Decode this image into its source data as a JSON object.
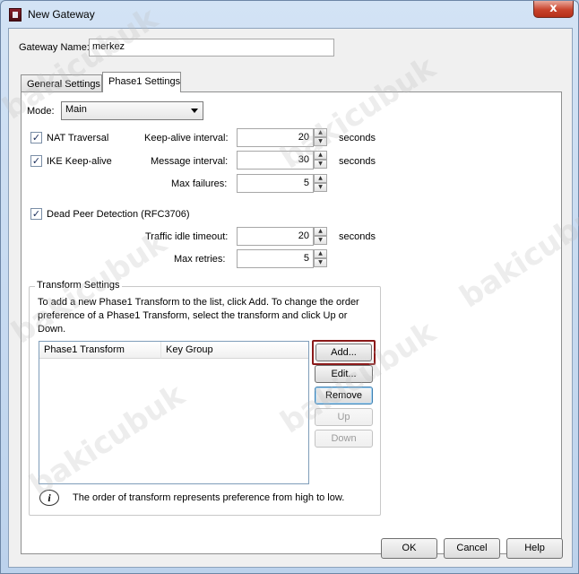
{
  "window": {
    "title": "New Gateway",
    "close_glyph": "x"
  },
  "gateway_name": {
    "label": "Gateway Name:",
    "value": "merkez"
  },
  "tabs": [
    {
      "label": "General Settings",
      "active": false
    },
    {
      "label": "Phase1 Settings",
      "active": true
    }
  ],
  "mode": {
    "label": "Mode:",
    "selected": "Main"
  },
  "nat_traversal": {
    "label": "NAT Traversal",
    "checked": true
  },
  "ike_keepalive": {
    "label": "IKE Keep-alive",
    "checked": true
  },
  "dpd": {
    "label": "Dead Peer Detection (RFC3706)",
    "checked": true
  },
  "check_glyph": "✓",
  "spinner_up": "▲",
  "spinner_down": "▼",
  "keepalive_interval": {
    "label": "Keep-alive interval:",
    "value": "20",
    "unit": "seconds"
  },
  "message_interval": {
    "label": "Message interval:",
    "value": "30",
    "unit": "seconds"
  },
  "max_failures": {
    "label": "Max failures:",
    "value": "5"
  },
  "traffic_idle_timeout": {
    "label": "Traffic idle timeout:",
    "value": "20",
    "unit": "seconds"
  },
  "max_retries": {
    "label": "Max retries:",
    "value": "5"
  },
  "transform": {
    "legend": "Transform Settings",
    "description": "To add a new Phase1 Transform to the list, click Add. To change the order preference of a Phase1 Transform, select the transform and click Up or Down.",
    "columns": [
      "Phase1 Transform",
      "Key Group"
    ],
    "buttons": {
      "add": "Add...",
      "edit": "Edit...",
      "remove": "Remove",
      "up": "Up",
      "down": "Down"
    },
    "note": "The order of transform represents preference from high to low."
  },
  "footer": {
    "ok": "OK",
    "cancel": "Cancel",
    "help": "Help"
  },
  "watermark": "bakicubuk",
  "colors": {
    "highlight": "#8b1a1a",
    "title_bar": "#bcd2ec",
    "close_button": "#c8432c"
  }
}
